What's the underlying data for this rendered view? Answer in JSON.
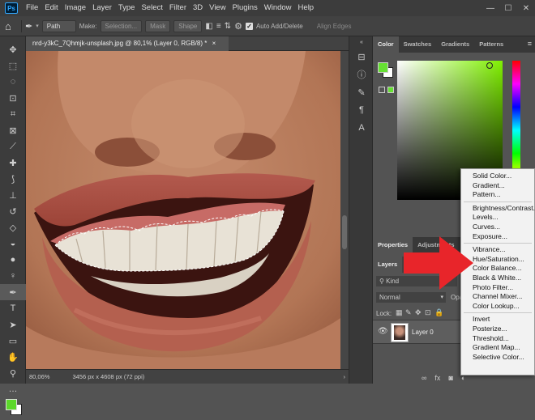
{
  "menubar": {
    "logo": "Ps",
    "items": [
      "File",
      "Edit",
      "Image",
      "Layer",
      "Type",
      "Select",
      "Filter",
      "3D",
      "View",
      "Plugins",
      "Window",
      "Help"
    ],
    "minimize": "—",
    "restore": "☐",
    "close": "✕"
  },
  "options": {
    "path_mode": "Path",
    "make_label": "Make:",
    "selection": "Selection...",
    "mask": "Mask",
    "shape": "Shape",
    "auto_add_delete": "Auto Add/Delete",
    "align_edges": "Align Edges"
  },
  "document": {
    "tab_title": "nrd-y3kC_7Qhmjk-unsplash.jpg @ 80,1% (Layer 0, RGB/8) *",
    "tab_close": "×",
    "zoom": "80,06%",
    "info": "3456 px x 4608 px (72 ppi)",
    "status_arrow": "›"
  },
  "color_panel": {
    "tabs": [
      "Color",
      "Swatches",
      "Gradients",
      "Patterns"
    ],
    "fg_color": "#66e033",
    "hue_color": "#7ff000"
  },
  "properties_panel": {
    "tabs": [
      "Properties",
      "Adjustments",
      "Li"
    ]
  },
  "layers_panel": {
    "tab": "Layers",
    "search_kind": "Kind",
    "blend_mode": "Normal",
    "opacity_label": "Opa",
    "lock_label": "Lock:",
    "layer_name": "Layer 0"
  },
  "adjustment_menu": {
    "groups": [
      [
        "Solid Color...",
        "Gradient...",
        "Pattern..."
      ],
      [
        "Brightness/Contrast...",
        "Levels...",
        "Curves...",
        "Exposure..."
      ],
      [
        "Vibrance...",
        "Hue/Saturation...",
        "Color Balance...",
        "Black & White...",
        "Photo Filter...",
        "Channel Mixer...",
        "Color Lookup..."
      ],
      [
        "Invert",
        "Posterize...",
        "Threshold...",
        "Gradient Map...",
        "Selective Color..."
      ]
    ]
  },
  "colors": {
    "arrow": "#e8252a",
    "selection": "#ffffff"
  }
}
